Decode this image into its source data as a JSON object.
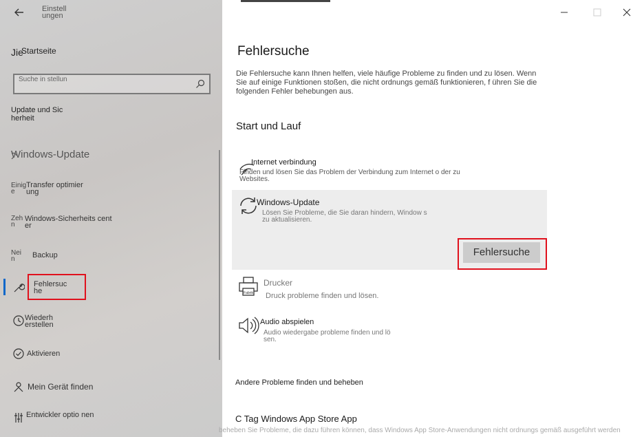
{
  "sidebar": {
    "app_title": "Einstell ungen",
    "home_prefix": "Jie",
    "home": "Startseite",
    "search_placeholder": "Suche in stellun",
    "category": "Update und Sic herheit",
    "section": "Windows-Update",
    "items": [
      {
        "prefix": "Einig e",
        "label": "Transfer optimier ung"
      },
      {
        "prefix": "Zeh n",
        "label": "Windows-Sicherheits cent er"
      },
      {
        "prefix": "Nei n",
        "label": "Backup"
      },
      {
        "label": "Fehlersuc he"
      },
      {
        "label": "Wiederh erstellen"
      },
      {
        "label": "Aktivieren"
      },
      {
        "label": "Mein Gerät finden"
      },
      {
        "label": "Entwickler optio nen"
      }
    ]
  },
  "main": {
    "title": "Fehlersuche",
    "description": "Die Fehlersuche kann Ihnen helfen, viele häufige Probleme zu finden und zu lösen. Wenn Sie auf einige Funktionen stoßen, die nicht ordnungs gemäß funktionieren, f ühren Sie die folgenden Fehler behebungen aus.",
    "subheading": "Start und Lauf",
    "tiles": [
      {
        "title": "Internet verbindung",
        "desc": "Finden und lösen Sie das Problem der Verbindung zum Internet o der zu Websites."
      },
      {
        "title": "Windows-Update",
        "desc": "Lösen Sie Probleme, die Sie daran hindern, Window s zu aktualisieren."
      },
      {
        "title": "Drucker",
        "desc": "Druck probleme finden und lösen."
      },
      {
        "title": "Audio abspielen",
        "desc": "Audio wiedergabe probleme finden und lö sen."
      }
    ],
    "run_button": "Fehlersuche",
    "printer_icon_label": "Fabrik",
    "other_heading": "Andere Probleme finden und beheben",
    "store_item": "C Tag Windows App Store App",
    "overlay_text": "beheben Sie Probleme, die dazu führen können, dass Windows App Store-Anwendungen nicht ordnungs gemäß ausgeführt werden"
  },
  "colors": {
    "accent": "#0a67c9",
    "highlight": "#e0101c",
    "selected_tile": "#ededed"
  }
}
